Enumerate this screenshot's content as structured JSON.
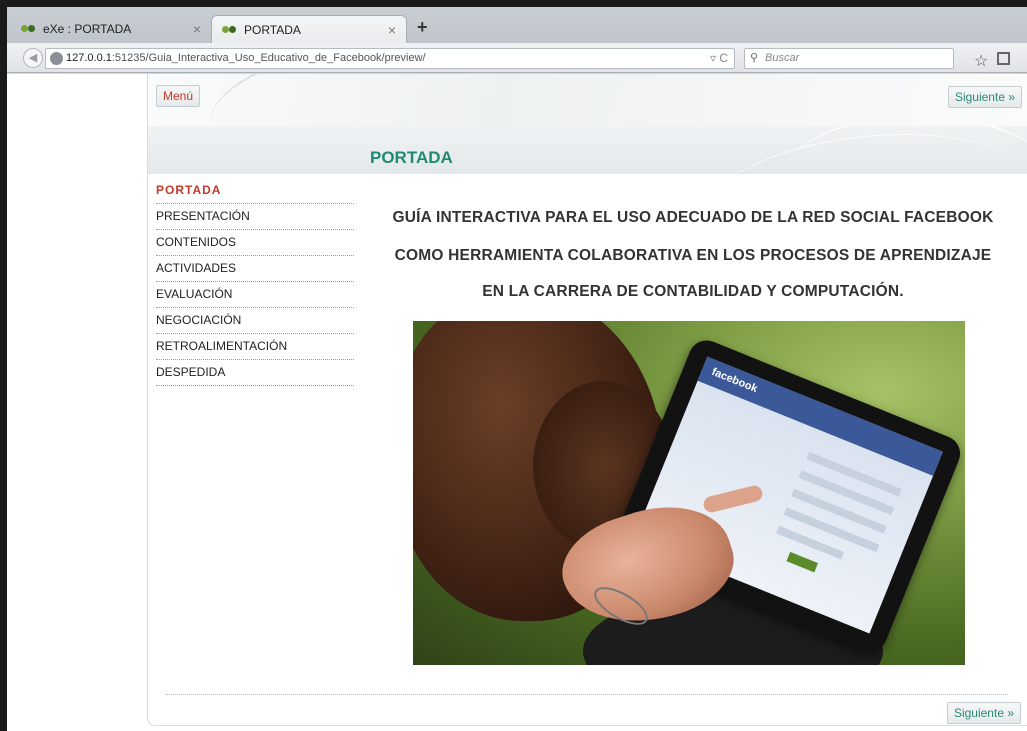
{
  "browser": {
    "tabs": [
      {
        "title": "eXe : PORTADA",
        "close": "×"
      },
      {
        "title": "PORTADA",
        "close": "×"
      }
    ],
    "new_tab": "+",
    "url_host": "127.0.0.1",
    "url_rest": ":51235/Guia_Interactiva_Uso_Educativo_de_Facebook/preview/",
    "url_tools": "▿ C",
    "search_placeholder": "Buscar"
  },
  "page": {
    "menu_button": "Menú",
    "next_button": "Siguiente »",
    "heading": "PORTADA",
    "nav": [
      "PORTADA",
      "PRESENTACIÓN",
      "CONTENIDOS",
      "ACTIVIDADES",
      "EVALUACIÓN",
      "NEGOCIACIÓN",
      "RETROALIMENTACIÓN",
      "DESPEDIDA"
    ],
    "title_lines": [
      "GUÍA INTERACTIVA PARA EL USO ADECUADO DE LA RED SOCIAL FACEBOOK",
      "COMO HERRAMIENTA COLABORATIVA EN LOS PROCESOS DE APRENDIZAJE",
      "EN LA CARRERA DE CONTABILIDAD Y COMPUTACIÓN."
    ],
    "hero_screen_text": "facebook"
  },
  "colors": {
    "accent_green": "#1f8a74",
    "accent_red": "#c0392b",
    "facebook_blue": "#3b5998"
  }
}
